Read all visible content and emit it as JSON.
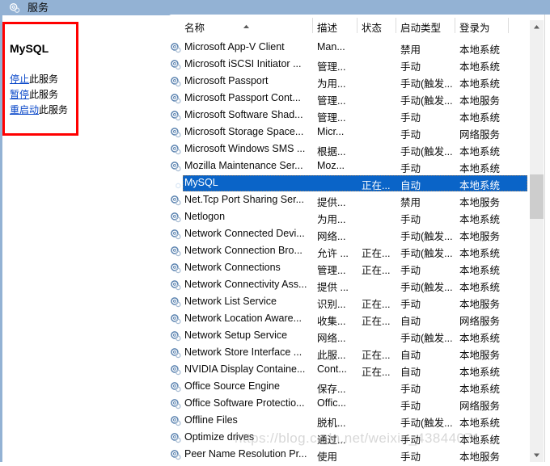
{
  "window": {
    "title": "服务",
    "icon": "services-gear-icon"
  },
  "detail_pane": {
    "service_name": "MySQL",
    "actions": [
      {
        "link": "停止",
        "suffix": "此服务"
      },
      {
        "link": "暂停",
        "suffix": "此服务"
      },
      {
        "link": "重启动",
        "suffix": "此服务"
      }
    ]
  },
  "list": {
    "columns": [
      {
        "key": "name",
        "label": "名称"
      },
      {
        "key": "desc",
        "label": "描述"
      },
      {
        "key": "status",
        "label": "状态"
      },
      {
        "key": "start",
        "label": "启动类型"
      },
      {
        "key": "logon",
        "label": "登录为"
      }
    ],
    "sort": {
      "column": "名称",
      "direction": "ascending",
      "icon": "caret-up-icon"
    },
    "rows": [
      {
        "name": "Microsoft App-V Client",
        "desc": "Man...",
        "status": "",
        "start": "禁用",
        "logon": "本地系统",
        "selected": false
      },
      {
        "name": "Microsoft iSCSI Initiator ...",
        "desc": "管理...",
        "status": "",
        "start": "手动",
        "logon": "本地系统",
        "selected": false
      },
      {
        "name": "Microsoft Passport",
        "desc": "为用...",
        "status": "",
        "start": "手动(触发...",
        "logon": "本地系统",
        "selected": false
      },
      {
        "name": "Microsoft Passport Cont...",
        "desc": "管理...",
        "status": "",
        "start": "手动(触发...",
        "logon": "本地服务",
        "selected": false
      },
      {
        "name": "Microsoft Software Shad...",
        "desc": "管理...",
        "status": "",
        "start": "手动",
        "logon": "本地系统",
        "selected": false
      },
      {
        "name": "Microsoft Storage Space...",
        "desc": "Micr...",
        "status": "",
        "start": "手动",
        "logon": "网络服务",
        "selected": false
      },
      {
        "name": "Microsoft Windows SMS ...",
        "desc": "根据...",
        "status": "",
        "start": "手动(触发...",
        "logon": "本地系统",
        "selected": false
      },
      {
        "name": "Mozilla Maintenance Ser...",
        "desc": "Moz...",
        "status": "",
        "start": "手动",
        "logon": "本地系统",
        "selected": false
      },
      {
        "name": "MySQL",
        "desc": "",
        "status": "正在...",
        "start": "自动",
        "logon": "本地系统",
        "selected": true
      },
      {
        "name": "Net.Tcp Port Sharing Ser...",
        "desc": "提供...",
        "status": "",
        "start": "禁用",
        "logon": "本地服务",
        "selected": false
      },
      {
        "name": "Netlogon",
        "desc": "为用...",
        "status": "",
        "start": "手动",
        "logon": "本地系统",
        "selected": false
      },
      {
        "name": "Network Connected Devi...",
        "desc": "网络...",
        "status": "",
        "start": "手动(触发...",
        "logon": "本地服务",
        "selected": false
      },
      {
        "name": "Network Connection Bro...",
        "desc": "允许 ...",
        "status": "正在...",
        "start": "手动(触发...",
        "logon": "本地系统",
        "selected": false
      },
      {
        "name": "Network Connections",
        "desc": "管理...",
        "status": "正在...",
        "start": "手动",
        "logon": "本地系统",
        "selected": false
      },
      {
        "name": "Network Connectivity Ass...",
        "desc": "提供 ...",
        "status": "",
        "start": "手动(触发...",
        "logon": "本地系统",
        "selected": false
      },
      {
        "name": "Network List Service",
        "desc": "识别...",
        "status": "正在...",
        "start": "手动",
        "logon": "本地服务",
        "selected": false
      },
      {
        "name": "Network Location Aware...",
        "desc": "收集...",
        "status": "正在...",
        "start": "自动",
        "logon": "网络服务",
        "selected": false
      },
      {
        "name": "Network Setup Service",
        "desc": "网络...",
        "status": "",
        "start": "手动(触发...",
        "logon": "本地系统",
        "selected": false
      },
      {
        "name": "Network Store Interface ...",
        "desc": "此服...",
        "status": "正在...",
        "start": "自动",
        "logon": "本地服务",
        "selected": false
      },
      {
        "name": "NVIDIA Display Containe...",
        "desc": "Cont...",
        "status": "正在...",
        "start": "自动",
        "logon": "本地系统",
        "selected": false
      },
      {
        "name": "Office  Source Engine",
        "desc": "保存...",
        "status": "",
        "start": "手动",
        "logon": "本地系统",
        "selected": false
      },
      {
        "name": "Office Software Protectio...",
        "desc": "Offic...",
        "status": "",
        "start": "手动",
        "logon": "网络服务",
        "selected": false
      },
      {
        "name": "Offline Files",
        "desc": "脱机...",
        "status": "",
        "start": "手动(触发...",
        "logon": "本地系统",
        "selected": false
      },
      {
        "name": "Optimize drives",
        "desc": "通过...",
        "status": "",
        "start": "手动",
        "logon": "本地系统",
        "selected": false
      },
      {
        "name": "Peer Name Resolution Pr...",
        "desc": "使用",
        "status": "",
        "start": "手动",
        "logon": "本地服务",
        "selected": false
      }
    ]
  },
  "scrollbar": {
    "up_icon": "caret-up-icon",
    "down_icon": "caret-down-icon"
  },
  "watermark": {
    "text": "https://blog.csdn.net/weixin_43844071"
  },
  "colors": {
    "titlebar": "#93b2d4",
    "selection": "#0a64c8",
    "link": "#0645c8",
    "highlight_box": "#ff0000"
  }
}
